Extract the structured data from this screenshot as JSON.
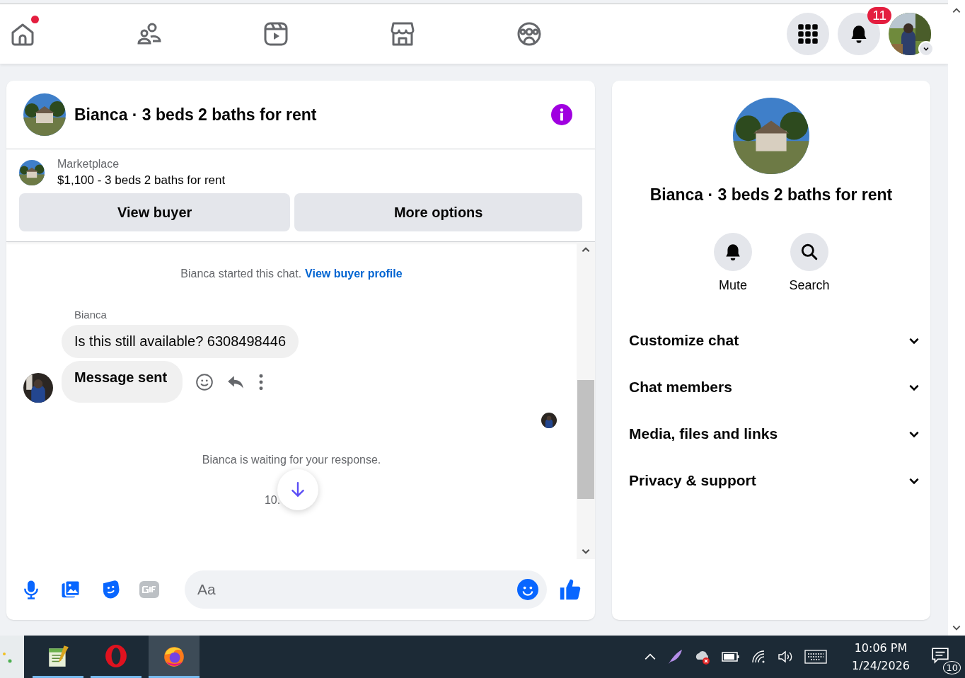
{
  "nav": {
    "tabs": [
      {
        "kind": "home",
        "dot": true
      },
      {
        "kind": "friends",
        "dot": false
      },
      {
        "kind": "video",
        "dot": false
      },
      {
        "kind": "marketplace",
        "dot": false
      },
      {
        "kind": "groups",
        "dot": false
      }
    ],
    "notifications_badge": "11"
  },
  "chat": {
    "title": "Bianca · 3 beds 2 baths for rent",
    "listing": {
      "source": "Marketplace",
      "title": "$1,100 - 3 beds 2 baths for rent"
    },
    "buttons": [
      "View buyer",
      "More options"
    ],
    "messages": [
      {
        "kind": "system",
        "text": "Bianca started this chat.",
        "link": "View buyer profile"
      },
      {
        "kind": "sender",
        "text": "Bianca"
      },
      {
        "kind": "bubble",
        "text": "Is this still available? 6308498446",
        "bold": false,
        "avatar": false
      },
      {
        "kind": "bubble",
        "text": "Message sent",
        "bold": true,
        "avatar": true
      },
      {
        "kind": "seen"
      },
      {
        "kind": "system",
        "text": "Bianca is waiting for your response."
      },
      {
        "kind": "time",
        "text": "10."
      }
    ],
    "composer": {
      "placeholder": "Aa"
    }
  },
  "details": {
    "title": "Bianca · 3 beds 2 baths for rent",
    "actions": [
      {
        "kind": "bell",
        "label": "Mute"
      },
      {
        "kind": "search",
        "label": "Search"
      }
    ],
    "sections": [
      {
        "label": "Customize chat",
        "expanded": false
      },
      {
        "label": "Chat members",
        "expanded": false
      },
      {
        "label": "Media, files and links",
        "expanded": false
      },
      {
        "label": "Privacy & support",
        "expanded": false
      }
    ]
  },
  "taskbar": {
    "apps": [
      {
        "kind": "notepad",
        "selected": false
      },
      {
        "kind": "opera",
        "selected": false
      },
      {
        "kind": "firefox",
        "selected": true
      }
    ],
    "time": "10:06 PM",
    "date": "1/24/2026",
    "notifications": "10"
  }
}
